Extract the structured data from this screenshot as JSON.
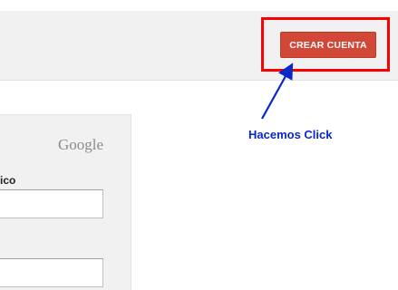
{
  "header": {
    "create_account_label": "CREAR CUENTA"
  },
  "annotation": {
    "text": "Hacemos Click",
    "color": "#0a28c8"
  },
  "login": {
    "brand": "Google",
    "email_label_partial": "ico",
    "email_value": "",
    "password_value": ""
  },
  "colors": {
    "button_bg": "#d14836",
    "highlight_border": "#ff0000",
    "panel_bg": "#f1f1f1"
  }
}
